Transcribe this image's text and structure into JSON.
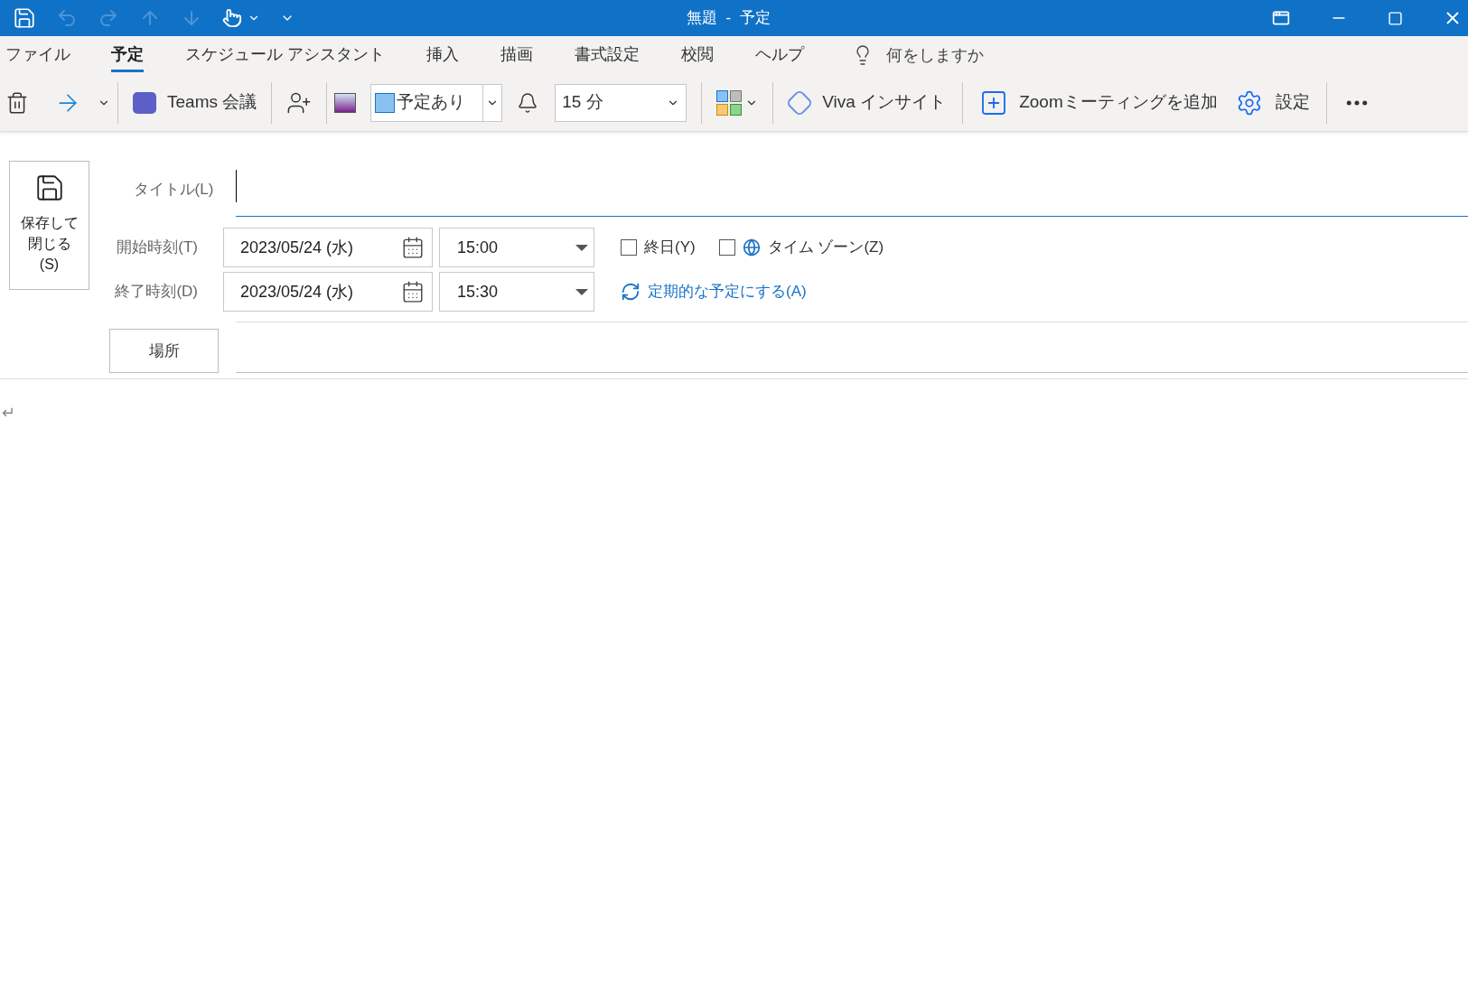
{
  "window": {
    "title": "無題  -  予定"
  },
  "tabs": [
    {
      "label": "ファイル",
      "selected": false
    },
    {
      "label": "予定",
      "selected": true
    },
    {
      "label": "スケジュール アシスタント",
      "selected": false
    },
    {
      "label": "挿入",
      "selected": false
    },
    {
      "label": "描画",
      "selected": false
    },
    {
      "label": "書式設定",
      "selected": false
    },
    {
      "label": "校閲",
      "selected": false
    },
    {
      "label": "ヘルプ",
      "selected": false
    }
  ],
  "tell_me": {
    "placeholder": "何をしますか"
  },
  "toolbar": {
    "teams": "Teams 会議",
    "show_as": {
      "value": "予定あり",
      "color": "#89c2f0"
    },
    "reminder": {
      "value": "15 分"
    },
    "viva": "Viva インサイト",
    "zoom": "Zoomミーティングを追加",
    "settings": "設定"
  },
  "form": {
    "save_close": [
      "保存して",
      "閉じる",
      "(S)"
    ],
    "title_label": "タイトル(L)",
    "start": {
      "label": "開始時刻(T)",
      "date": "2023/05/24 (水)",
      "time": "15:00"
    },
    "end": {
      "label": "終了時刻(D)",
      "date": "2023/05/24 (水)",
      "time": "15:30"
    },
    "all_day": {
      "label": "終日(Y)",
      "checked": false
    },
    "time_zone": {
      "label": "タイム ゾーン(Z)",
      "checked": false
    },
    "recurrence": "定期的な予定にする(A)",
    "location_button": "場所",
    "body_mark": "↵"
  }
}
